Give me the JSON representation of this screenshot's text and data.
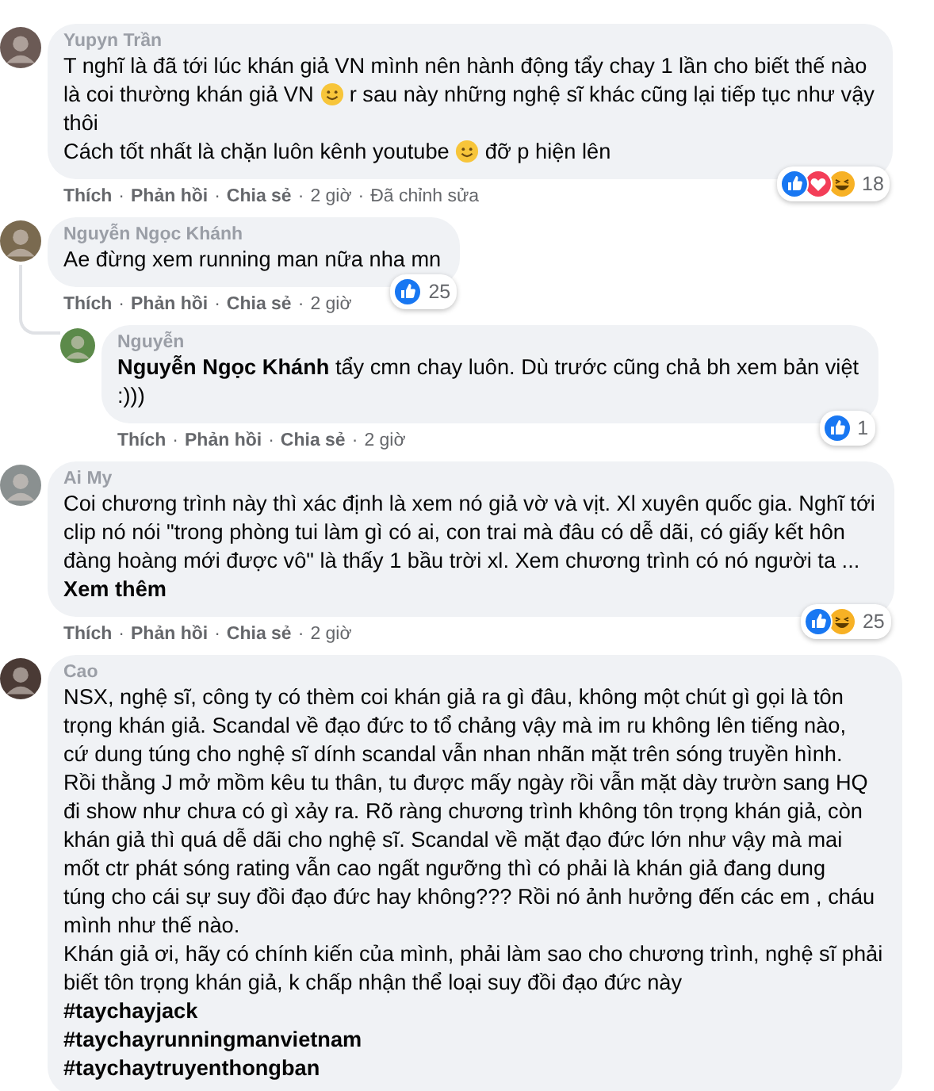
{
  "separator": "·",
  "comments": [
    {
      "name": "Yupyn Trần",
      "reply": false,
      "lines": [
        [
          {
            "kind": "text",
            "text": "T nghĩ là đã tới lúc khán giả VN mình nên hành động tẩy chay 1 lần cho biết thế nào"
          }
        ],
        [
          {
            "kind": "text",
            "text": "là coi thường khán giả VN "
          },
          {
            "kind": "emoji"
          },
          {
            "kind": "text",
            "text": " r sau này những nghệ sĩ khác cũng lại tiếp tục như vậy"
          }
        ],
        [
          {
            "kind": "text",
            "text": "thôi"
          }
        ],
        [
          {
            "kind": "text",
            "text": "Cách tốt nhất là chặn luôn kênh youtube "
          },
          {
            "kind": "emoji"
          },
          {
            "kind": "text",
            "text": " đỡ p hiện lên"
          }
        ]
      ],
      "reactions": [
        {
          "kind": "like"
        },
        {
          "kind": "love"
        },
        {
          "kind": "haha"
        }
      ],
      "count": "18",
      "actions": [
        "Thích",
        "Phản hồi",
        "Chia sẻ",
        "2 giờ",
        "Đã chỉnh sửa"
      ]
    },
    {
      "name": "Nguyễn Ngọc Khánh",
      "reply": false,
      "thread": true,
      "lines": [
        [
          {
            "kind": "text",
            "text": "Ae đừng xem running man nữa nha mn"
          }
        ]
      ],
      "reactions": [
        {
          "kind": "like"
        }
      ],
      "count": "25",
      "actions": [
        "Thích",
        "Phản hồi",
        "Chia sẻ",
        "2 giờ"
      ]
    },
    {
      "name": "Nguyễn",
      "reply": true,
      "lines": [
        [
          {
            "kind": "mention",
            "text": "Nguyễn Ngọc Khánh"
          },
          {
            "kind": "text",
            "text": " tẩy cmn chay luôn. Dù trước cũng chả bh xem bản việt"
          }
        ],
        [
          {
            "kind": "text",
            "text": ":)))"
          }
        ]
      ],
      "reactions": [
        {
          "kind": "like"
        }
      ],
      "count": "1",
      "actions": [
        "Thích",
        "Phản hồi",
        "Chia sẻ",
        "2 giờ"
      ]
    },
    {
      "name": "Ai My",
      "reply": false,
      "lines": [
        [
          {
            "kind": "text",
            "text": "Coi chương trình này thì xác định là xem nó giả vờ và vịt. Xl xuyên quốc gia. Nghĩ tới"
          }
        ],
        [
          {
            "kind": "text",
            "text": "clip nó nói \"trong phòng tui làm gì có ai, con trai mà đâu có dễ dãi, có giấy kết hôn"
          }
        ],
        [
          {
            "kind": "text",
            "text": "đàng hoàng mới được vô\" là thấy 1 bầu trời xl. Xem chương trình có nó người ta ..."
          }
        ],
        [
          {
            "kind": "more",
            "text": "Xem thêm"
          }
        ]
      ],
      "reactions": [
        {
          "kind": "like"
        },
        {
          "kind": "haha"
        }
      ],
      "count": "25",
      "actions": [
        "Thích",
        "Phản hồi",
        "Chia sẻ",
        "2 giờ"
      ]
    },
    {
      "name": "Cao",
      "reply": false,
      "lines": [
        [
          {
            "kind": "text",
            "text": "NSX, nghệ sĩ, công ty có thèm coi khán giả ra gì đâu, không một chút gì gọi là tôn"
          }
        ],
        [
          {
            "kind": "text",
            "text": "trọng khán giả. Scandal về đạo đức to tổ chảng vậy mà im ru không lên tiếng nào,"
          }
        ],
        [
          {
            "kind": "text",
            "text": "cứ dung túng cho nghệ sĩ dính scandal vẫn nhan nhãn mặt trên sóng truyền hình."
          }
        ],
        [
          {
            "kind": "text",
            "text": "Rồi thằng J mở mồm kêu tu thân, tu được mấy ngày rồi vẫn mặt dày trườn sang HQ"
          }
        ],
        [
          {
            "kind": "text",
            "text": "đi show như chưa có gì xảy ra. Rõ ràng chương trình không tôn trọng khán giả, còn"
          }
        ],
        [
          {
            "kind": "text",
            "text": "khán giả thì quá dễ dãi cho nghệ sĩ. Scandal về mặt đạo đức lớn như vậy mà mai"
          }
        ],
        [
          {
            "kind": "text",
            "text": "mốt ctr phát sóng rating vẫn cao ngất ngưỡng thì có phải là khán giả đang dung"
          }
        ],
        [
          {
            "kind": "text",
            "text": "túng cho cái sự suy đồi đạo đức hay không??? Rồi nó ảnh hưởng đến các em , cháu"
          }
        ],
        [
          {
            "kind": "text",
            "text": "mình như thế nào."
          }
        ],
        [
          {
            "kind": "text",
            "text": "Khán giả ơi, hãy có chính kiến của mình, phải làm sao cho chương trình, nghệ sĩ phải"
          }
        ],
        [
          {
            "kind": "text",
            "text": "biết tôn trọng khán giả, k chấp nhận thể loại suy đồi đạo đức này"
          }
        ],
        [
          {
            "kind": "hashtag",
            "text": "#taychayjack"
          }
        ],
        [
          {
            "kind": "hashtag",
            "text": "#taychayrunningmanvietnam"
          }
        ],
        [
          {
            "kind": "hashtag",
            "text": "#taychaytruyenthongban"
          }
        ]
      ]
    }
  ]
}
